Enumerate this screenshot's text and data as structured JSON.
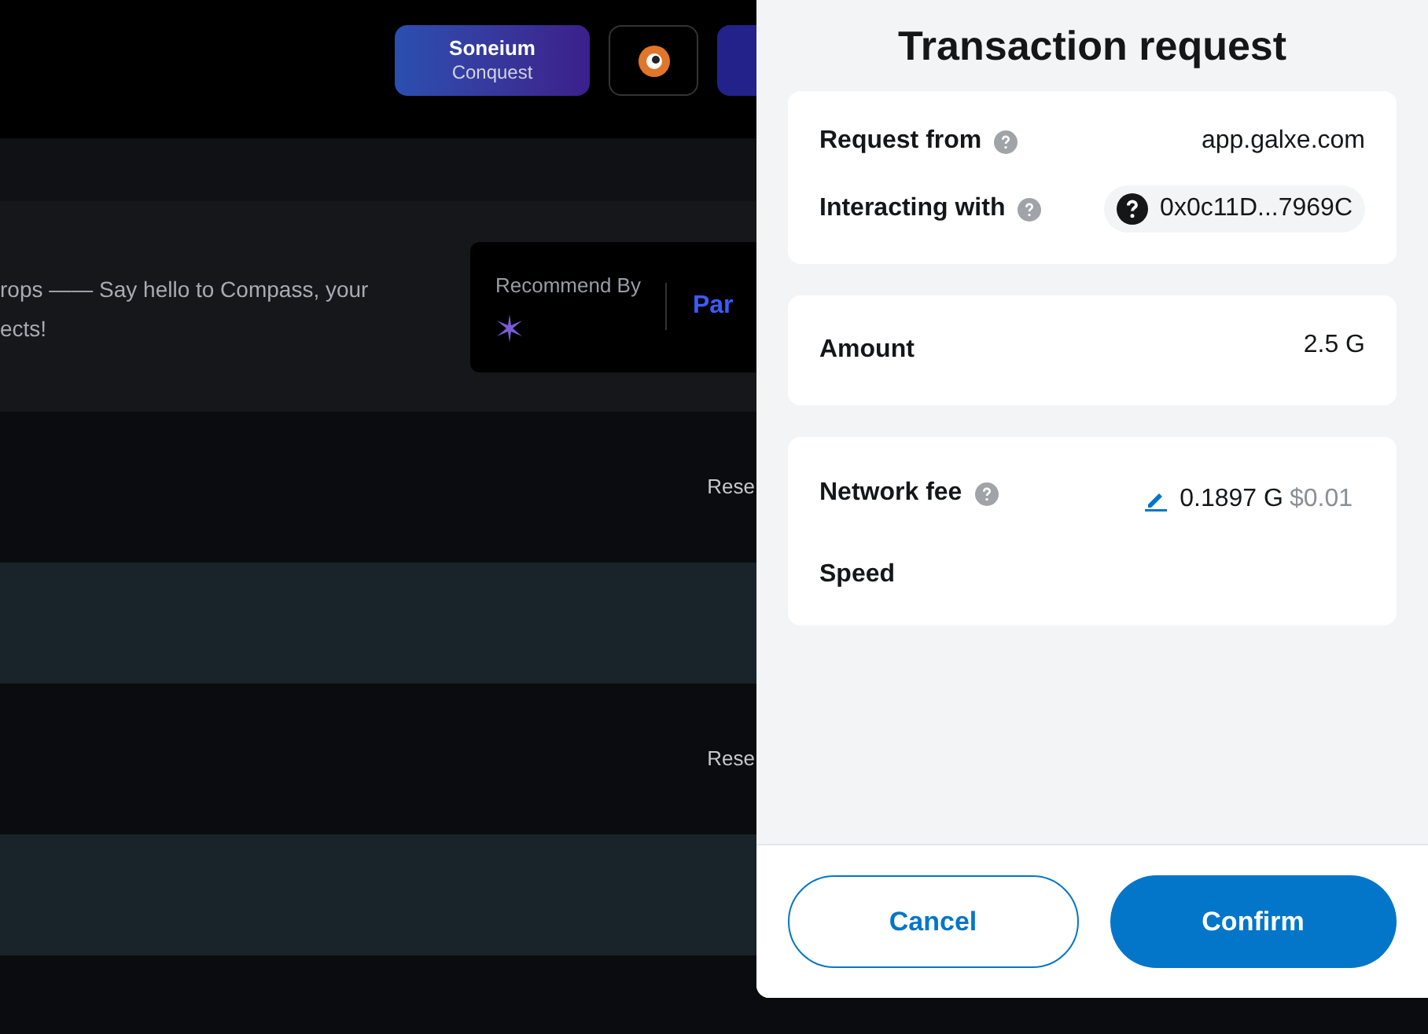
{
  "header": {
    "badge": {
      "title": "Soneium",
      "subtitle": "Conquest"
    }
  },
  "banner": {
    "description": [
      "rops —— Say hello to Compass, your",
      "ects!"
    ],
    "recommend_label": "Recommend By",
    "recommend_link": "Par"
  },
  "rows": [
    {
      "kind": "label",
      "text": "Rese"
    },
    {
      "kind": "band"
    },
    {
      "kind": "label",
      "text": "Rese"
    },
    {
      "kind": "band"
    }
  ],
  "dialog": {
    "title": "Transaction request",
    "request_from": {
      "label": "Request from",
      "value": "app.galxe.com"
    },
    "interacting_with": {
      "label": "Interacting with",
      "value": "0x0c11D...7969C"
    },
    "amount": {
      "label": "Amount",
      "value": "2.5 G"
    },
    "network_fee": {
      "label": "Network fee",
      "value": "0.1897 G",
      "fiat": "$0.01"
    },
    "speed": {
      "label": "Speed"
    },
    "buttons": [
      {
        "kind": "secondary",
        "label": "Cancel"
      },
      {
        "kind": "primary",
        "label": "Confirm"
      }
    ]
  }
}
